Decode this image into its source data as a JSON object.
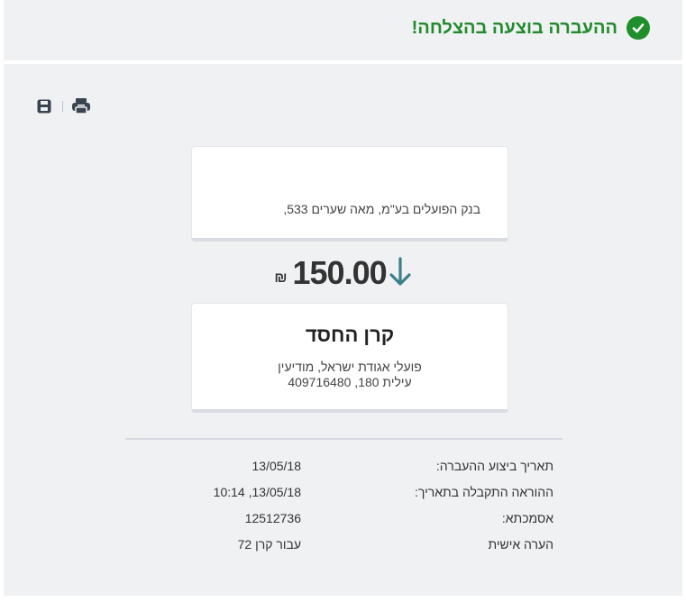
{
  "header": {
    "success_message": "ההעברה בוצעה בהצלחה!",
    "status_color": "#1f8f2c"
  },
  "toolbar": {
    "icons": [
      "save-icon",
      "print-icon"
    ]
  },
  "source": {
    "bank_line": "בנק הפועלים בע\"מ, מאה שערים 533,"
  },
  "transfer": {
    "amount": "150.00",
    "currency": "₪",
    "direction_icon": "arrow-down-icon",
    "accent_color": "#3d7f8a"
  },
  "beneficiary": {
    "name": "קרן החסד",
    "address_line1": "פועלי אגודת ישראל, מודיעין",
    "address_line2": "עילית 180, 409716480"
  },
  "details": [
    {
      "label": "תאריך ביצוע ההעברה:",
      "value": "13/05/18"
    },
    {
      "label": "ההוראה התקבלה בתאריך:",
      "value": "13/05/18, 10:14"
    },
    {
      "label": "אסמכתא:",
      "value": "12512736"
    },
    {
      "label": "הערה אישית",
      "value": "עבור קרן 72"
    }
  ]
}
